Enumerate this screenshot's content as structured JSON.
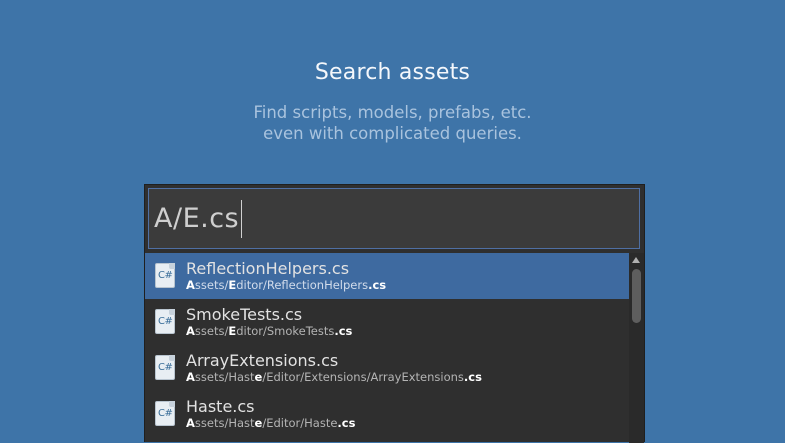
{
  "header": {
    "title": "Search assets",
    "subtitle_line1": "Find scripts, models, prefabs, etc.",
    "subtitle_line2": "even with complicated queries."
  },
  "search": {
    "query": "A/E.cs"
  },
  "results": [
    {
      "name": "ReflectionHelpers.cs",
      "selected": true,
      "path_segments": [
        {
          "text": "A",
          "match": true
        },
        {
          "text": "ssets/",
          "match": false
        },
        {
          "text": "E",
          "match": true
        },
        {
          "text": "ditor/ReflectionHelpers",
          "match": false
        },
        {
          "text": ".cs",
          "match": true
        }
      ]
    },
    {
      "name": "SmokeTests.cs",
      "selected": false,
      "path_segments": [
        {
          "text": "A",
          "match": true
        },
        {
          "text": "ssets/",
          "match": false
        },
        {
          "text": "E",
          "match": true
        },
        {
          "text": "ditor/SmokeTests",
          "match": false
        },
        {
          "text": ".cs",
          "match": true
        }
      ]
    },
    {
      "name": "ArrayExtensions.cs",
      "selected": false,
      "path_segments": [
        {
          "text": "A",
          "match": true
        },
        {
          "text": "ssets/Hast",
          "match": false
        },
        {
          "text": "e",
          "match": true
        },
        {
          "text": "/Editor/Extensions/ArrayExtensions",
          "match": false
        },
        {
          "text": ".cs",
          "match": true
        }
      ]
    },
    {
      "name": "Haste.cs",
      "selected": false,
      "path_segments": [
        {
          "text": "A",
          "match": true
        },
        {
          "text": "ssets/Hast",
          "match": false
        },
        {
          "text": "e",
          "match": true
        },
        {
          "text": "/Editor/Haste",
          "match": false
        },
        {
          "text": ".cs",
          "match": true
        }
      ]
    }
  ],
  "icon": {
    "name": "csharp-script-icon",
    "glyph": "C#"
  },
  "colors": {
    "background": "#3e74a8",
    "selection": "#3e6aa0",
    "panel": "#2f2f2f"
  }
}
